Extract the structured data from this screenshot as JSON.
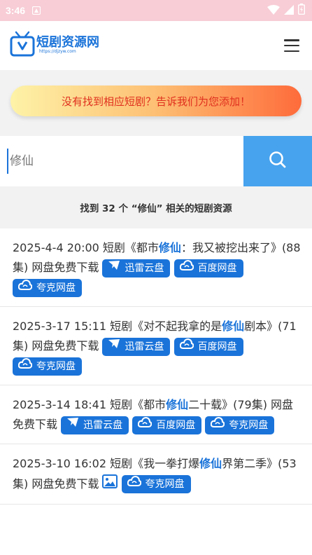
{
  "status": {
    "time": "3:46"
  },
  "header": {
    "logo_title": "短剧资源网",
    "logo_sub": "https://djzyw.com"
  },
  "banner": {
    "text": "没有找到相应短剧？告诉我们为您添加！"
  },
  "search": {
    "value": "修仙",
    "placeholder": "修仙"
  },
  "results": {
    "summary": "找到 32 个 “修仙” 相关的短剧资源"
  },
  "tags": {
    "xunlei": "迅雷云盘",
    "baidu": "百度网盘",
    "quark": "夸克网盘"
  },
  "items": [
    {
      "prefix": "2025-4-4 20:00 短剧《都市",
      "keyword": "修仙",
      "suffix": "：我又被挖出来了》(88集) 网盘免费下载"
    },
    {
      "prefix": "2025-3-17 15:11 短剧《对不起我拿的是",
      "keyword": "修仙",
      "suffix": "剧本》(71集) 网盘免费下载"
    },
    {
      "prefix": "2025-3-14 18:41 短剧《都市",
      "keyword": "修仙",
      "suffix": "二十载》(79集) 网盘免费下载"
    },
    {
      "prefix": "2025-3-10 16:02 短剧《我一拳打爆",
      "keyword": "修仙",
      "suffix": "界第二季》(53集) 网盘免费下载"
    }
  ],
  "colors": {
    "accent": "#1a73d9",
    "search_button": "#47a3ee",
    "status_bar": "#f8cdd6",
    "banner_text": "#e0301e"
  }
}
